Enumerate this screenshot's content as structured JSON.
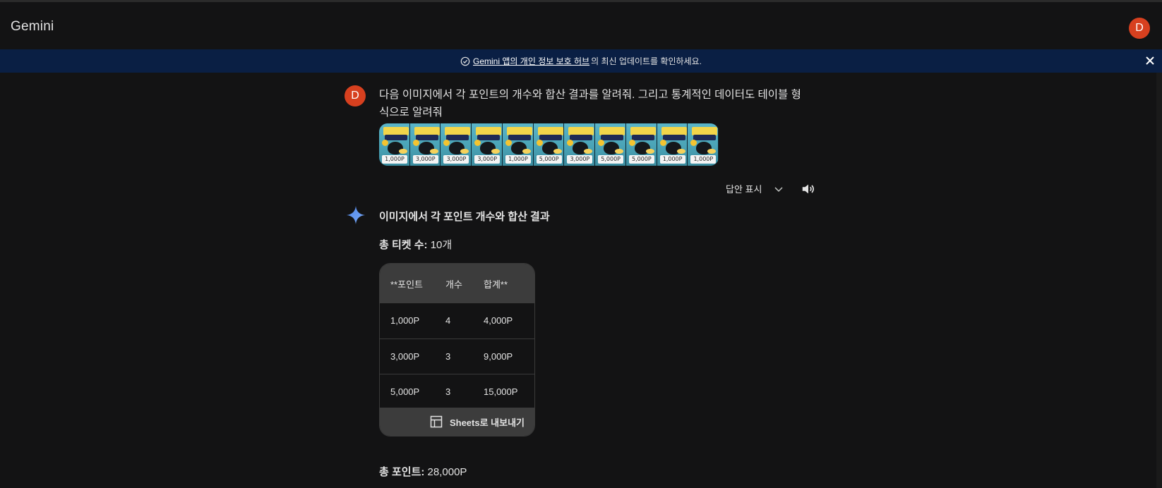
{
  "app": {
    "title": "Gemini",
    "avatar_letter": "D"
  },
  "banner": {
    "link_text": "Gemini 앱의 개인 정보 보호 허브",
    "rest_text": "의 최신 업데이트를 확인하세요."
  },
  "user_message": {
    "avatar_letter": "D",
    "text": "다음 이미지에서 각 포인트의 개수와 합산 결과를 알려줘. 그리고 통계적인 데이터도 테이블 형식으로 알려줘",
    "ticket_labels": [
      "1,000P",
      "3,000P",
      "3,000P",
      "3,000P",
      "1,000P",
      "5,000P",
      "3,000P",
      "5,000P",
      "5,000P",
      "1,000P",
      "1,000P"
    ]
  },
  "controls": {
    "show_answers": "답안 표시"
  },
  "response": {
    "heading": "이미지에서 각 포인트 개수와 합산 결과",
    "total_tickets_label": "총 티켓 수:",
    "total_tickets_value": "10개",
    "table": {
      "headers": [
        "**포인트",
        "개수",
        "합계**"
      ],
      "rows": [
        [
          "1,000P",
          "4",
          "4,000P"
        ],
        [
          "3,000P",
          "3",
          "9,000P"
        ],
        [
          "5,000P",
          "3",
          "15,000P"
        ]
      ],
      "export_label": "Sheets로 내보내기"
    },
    "total_points_label": "총 포인트:",
    "total_points_value": "28,000P"
  }
}
